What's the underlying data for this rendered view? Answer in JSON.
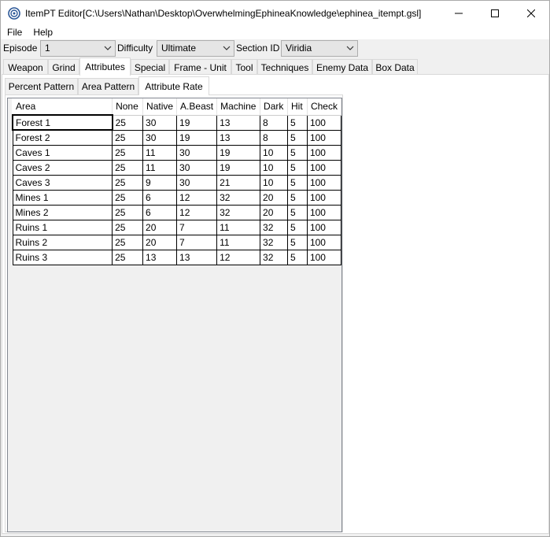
{
  "window": {
    "title": "ItemPT Editor[C:\\Users\\Nathan\\Desktop\\OverwhelmingEphineaKnowledge\\ephinea_itempt.gsl]",
    "icon": "app-target-icon"
  },
  "menu": {
    "file": "File",
    "help": "Help"
  },
  "toolbar": {
    "episode_label": "Episode",
    "episode_value": "1",
    "difficulty_label": "Difficulty",
    "difficulty_value": "Ultimate",
    "section_label": "Section ID",
    "section_value": "Viridia"
  },
  "tabs": [
    "Weapon",
    "Grind",
    "Attributes",
    "Special",
    "Frame - Unit",
    "Tool",
    "Techniques",
    "Enemy Data",
    "Box Data"
  ],
  "active_tab": "Attributes",
  "subtabs": [
    "Percent Pattern",
    "Area Pattern",
    "Attribute Rate"
  ],
  "active_subtab": "Attribute Rate",
  "grid": {
    "columns": [
      "Area",
      "None",
      "Native",
      "A.Beast",
      "Machine",
      "Dark",
      "Hit",
      "Check"
    ],
    "rows": [
      [
        "Forest 1",
        "25",
        "30",
        "19",
        "13",
        "8",
        "5",
        "100"
      ],
      [
        "Forest 2",
        "25",
        "30",
        "19",
        "13",
        "8",
        "5",
        "100"
      ],
      [
        "Caves 1",
        "25",
        "11",
        "30",
        "19",
        "10",
        "5",
        "100"
      ],
      [
        "Caves 2",
        "25",
        "11",
        "30",
        "19",
        "10",
        "5",
        "100"
      ],
      [
        "Caves 3",
        "25",
        "9",
        "30",
        "21",
        "10",
        "5",
        "100"
      ],
      [
        "Mines 1",
        "25",
        "6",
        "12",
        "32",
        "20",
        "5",
        "100"
      ],
      [
        "Mines 2",
        "25",
        "6",
        "12",
        "32",
        "20",
        "5",
        "100"
      ],
      [
        "Ruins 1",
        "25",
        "20",
        "7",
        "11",
        "32",
        "5",
        "100"
      ],
      [
        "Ruins 2",
        "25",
        "20",
        "7",
        "11",
        "32",
        "5",
        "100"
      ],
      [
        "Ruins 3",
        "25",
        "13",
        "13",
        "12",
        "32",
        "5",
        "100"
      ]
    ]
  },
  "colors": {
    "grid_bg": "#f0f0f0",
    "panel_bg": "#ffffff",
    "chrome": "#f0f0f0"
  }
}
